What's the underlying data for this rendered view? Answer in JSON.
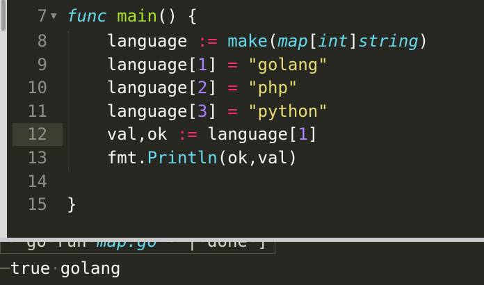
{
  "editor": {
    "lines": [
      {
        "num": "7",
        "text": "func main() {"
      },
      {
        "num": "8",
        "text": "language := make(map[int]string)"
      },
      {
        "num": "9",
        "text": "language[1] = \"golang\""
      },
      {
        "num": "10",
        "text": "language[2] = \"php\""
      },
      {
        "num": "11",
        "text": "language[3] = \"python\""
      },
      {
        "num": "12",
        "text": "val,ok := language[1]"
      },
      {
        "num": "13",
        "text": "fmt.Println(ok,val)"
      },
      {
        "num": "14",
        "text": ""
      },
      {
        "num": "15",
        "text": "}"
      }
    ],
    "active_line": "12",
    "fold_marker_line": "7"
  },
  "output": {
    "command": {
      "word1": "go",
      "word2": "run",
      "file": "map.go",
      "pipe": "|",
      "status": "done",
      "bracket": "]"
    },
    "result": {
      "word1": "true",
      "word2": "golang"
    }
  },
  "colors": {
    "background": "#272822",
    "keyword": "#66d9ef",
    "function": "#a6e22e",
    "operator": "#f92672",
    "number": "#ae81ff",
    "string": "#e6db74",
    "text": "#f8f8f2",
    "gutter": "#8f908a"
  },
  "icons": {
    "fold_arrow": "triangle-down-icon"
  }
}
